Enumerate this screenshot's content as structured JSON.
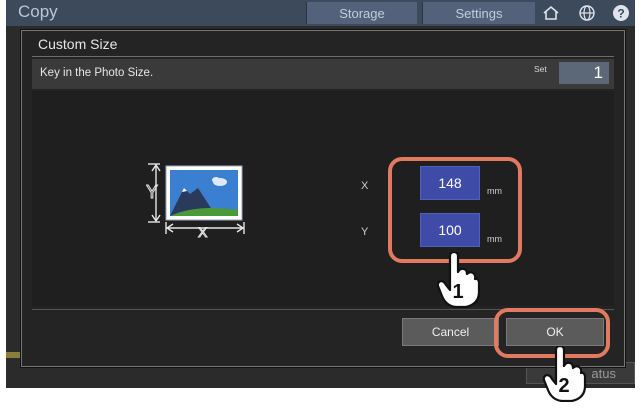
{
  "app": {
    "title": "Copy",
    "tabs": [
      "Storage",
      "Settings"
    ],
    "status_label": "atus"
  },
  "dialog": {
    "title": "Custom Size",
    "message": "Key in the Photo Size.",
    "set_label": "Set",
    "set_value": "1",
    "x_label": "X",
    "y_label": "Y",
    "x_value": "148",
    "y_value": "100",
    "unit": "mm",
    "illustration_x": "X",
    "illustration_y": "Y",
    "cancel_label": "Cancel",
    "ok_label": "OK"
  },
  "callouts": {
    "step1": "1",
    "step2": "2",
    "highlight_color": "#e17a61"
  },
  "icons": [
    "home-icon",
    "globe-icon",
    "help-icon",
    "photo-icon",
    "pointing-hand-icon"
  ]
}
